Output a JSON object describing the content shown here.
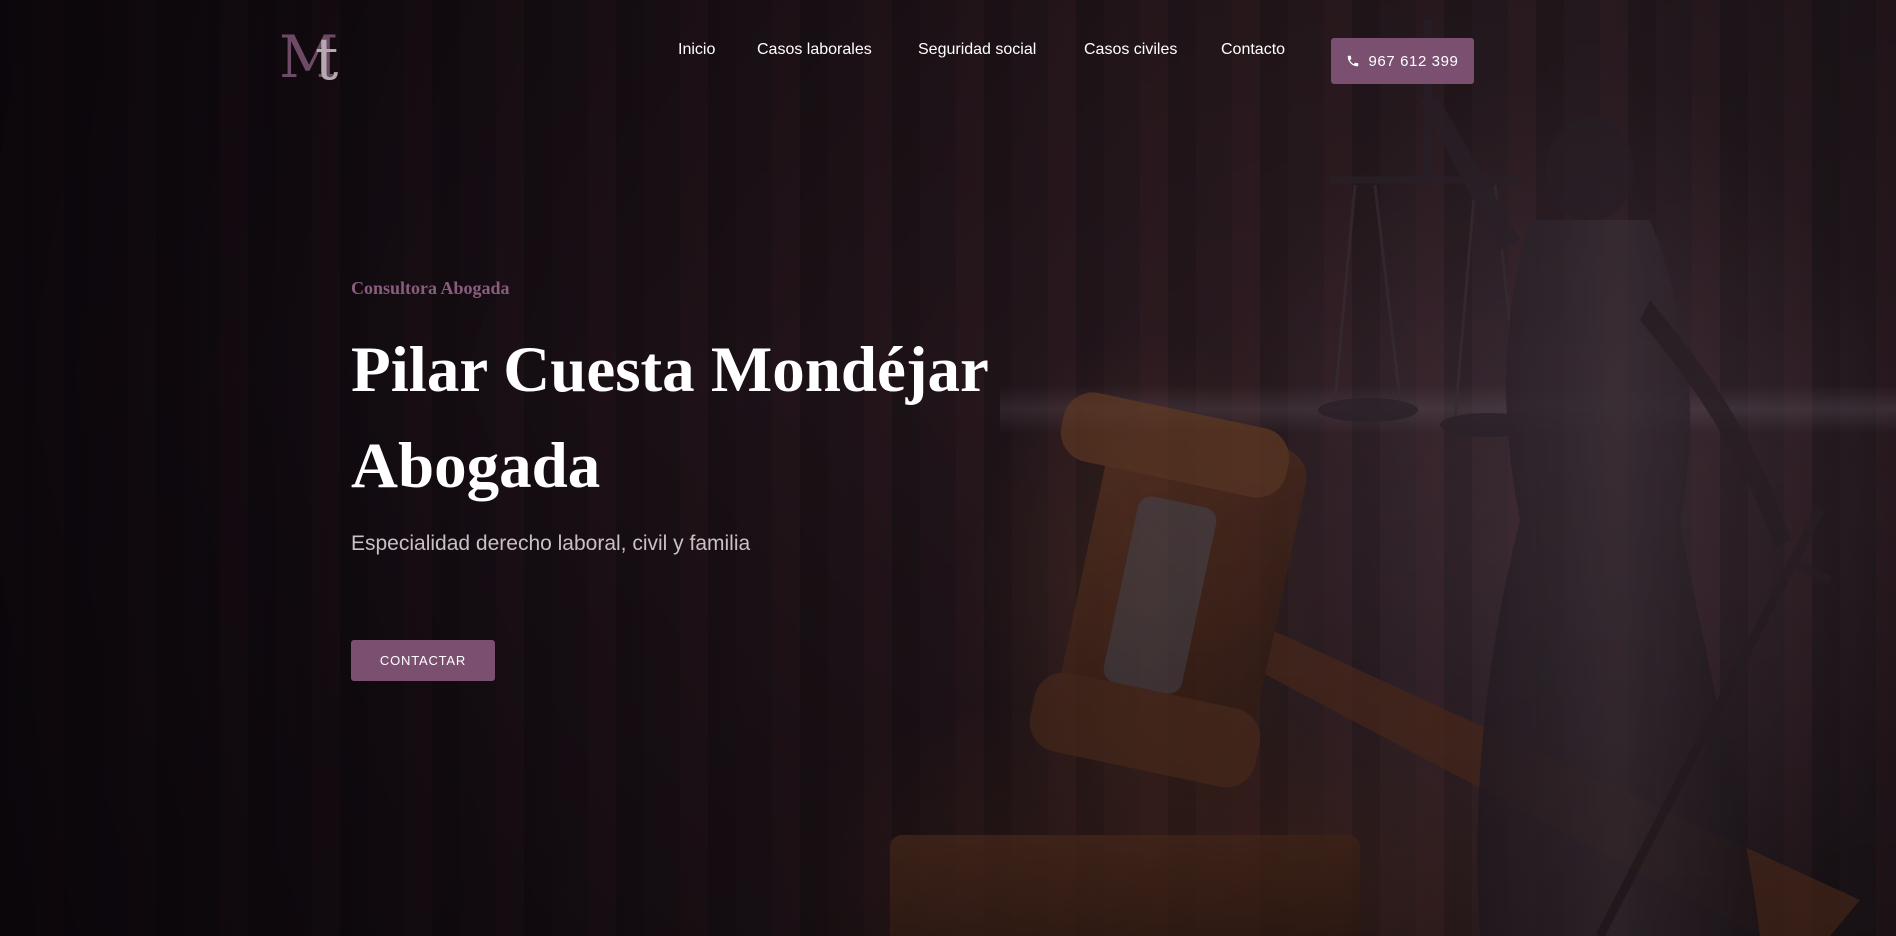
{
  "header": {
    "logo_alt": "MT",
    "nav": [
      {
        "label": "Inicio"
      },
      {
        "label": "Casos laborales"
      },
      {
        "label": "Seguridad social"
      },
      {
        "label": "Casos civiles"
      },
      {
        "label": "Contacto"
      }
    ],
    "phone": {
      "icon": "phone-icon",
      "label": "967 612 399"
    }
  },
  "hero": {
    "eyebrow": "Consultora Abogada",
    "headline_line1": "Pilar Cuesta Mondéjar",
    "headline_line2": "Abogada",
    "subtitle": "Especialidad derecho laboral, civil y familia",
    "cta_label": "CONTACTAR"
  },
  "colors": {
    "accent": "#7a4f70",
    "eyebrow": "#8a5c7e",
    "background": "#1a1216",
    "headline": "#ffffff"
  }
}
